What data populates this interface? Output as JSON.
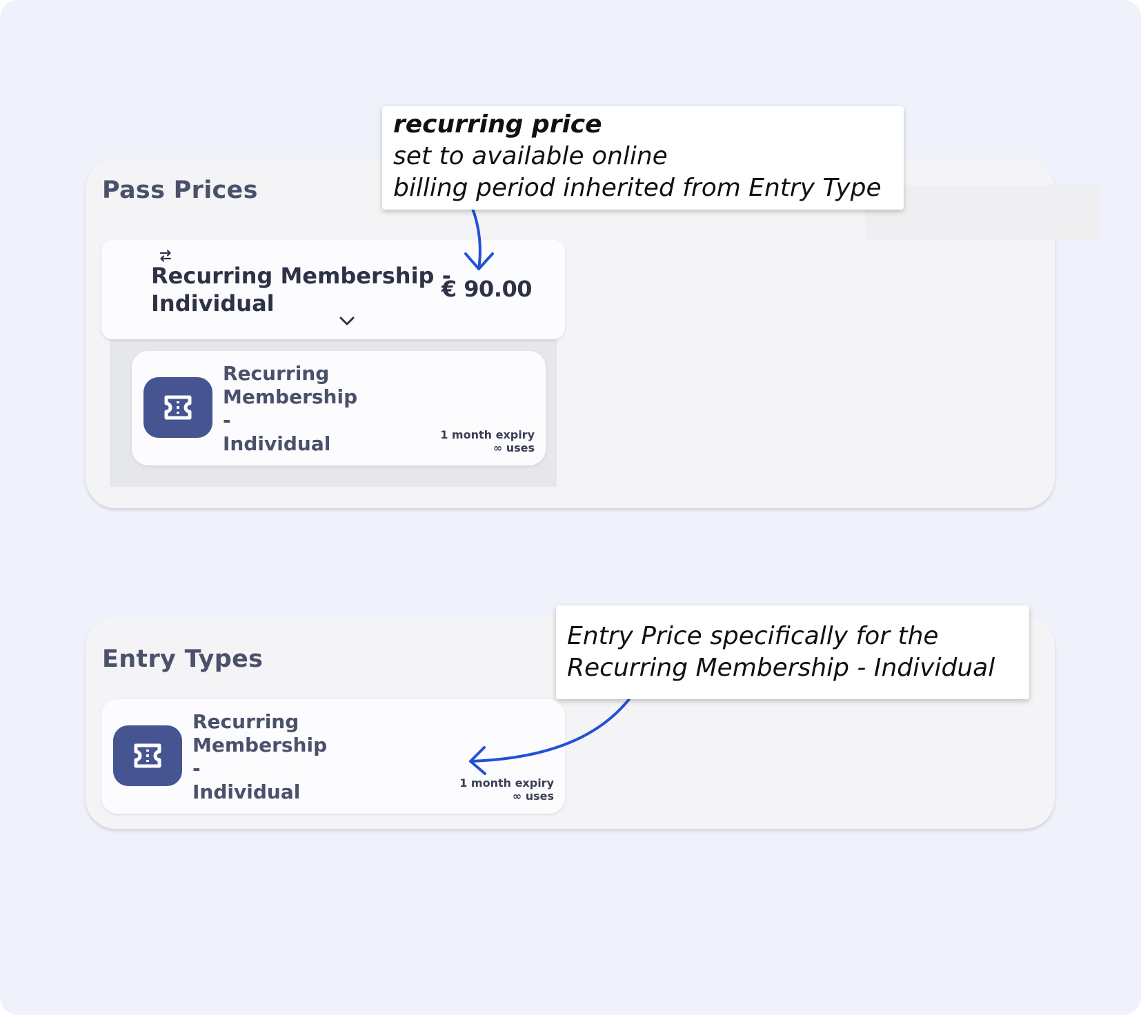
{
  "pass_prices": {
    "title": "Pass Prices",
    "price_row": {
      "name": "Recurring Membership - Individual",
      "amount": "€ 90.00",
      "recurring_icon": "repeat-icon",
      "expand_icon": "chevron-down-icon"
    },
    "entry_card": {
      "icon": "ticket-icon",
      "name_lines": [
        "Recurring",
        "Membership",
        "-",
        "Individual"
      ],
      "expiry": "1 month expiry",
      "uses": "∞ uses"
    }
  },
  "entry_types": {
    "title": "Entry Types",
    "entry_card": {
      "icon": "ticket-icon",
      "name_lines": [
        "Recurring",
        "Membership",
        "-",
        "Individual"
      ],
      "expiry": "1 month expiry",
      "uses": "∞ uses"
    }
  },
  "callouts": {
    "recurring": {
      "line1": "recurring price",
      "line2": "set to available online",
      "line3": "billing period inherited from Entry Type"
    },
    "entry": {
      "text": "Entry Price specifically for the Recurring Membership - Individual"
    }
  },
  "colors": {
    "background": "#eff2fa",
    "panel": "#f4f4f6",
    "ticket_tile": "#465491",
    "arrow": "#2350d8"
  }
}
